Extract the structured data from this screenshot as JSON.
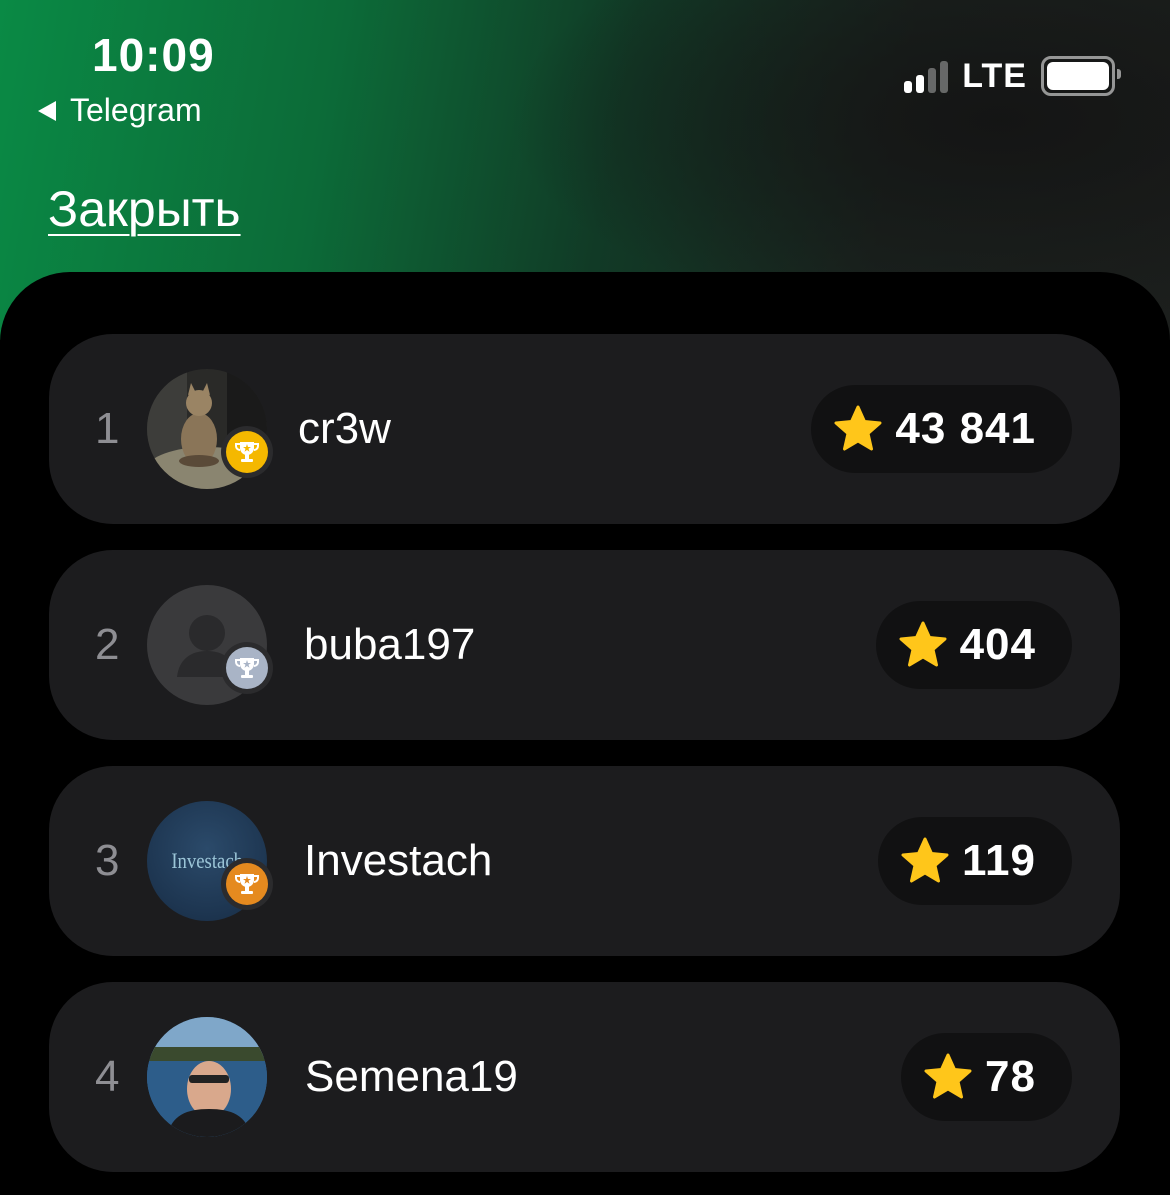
{
  "status_bar": {
    "time": "10:09",
    "back_app": "Telegram",
    "network": "LTE"
  },
  "header": {
    "close_label": "Закрыть"
  },
  "colors": {
    "gold_medal": "#f5b800",
    "silver_medal": "#a9b4c6",
    "bronze_medal": "#e58a1f",
    "star": "#ffc61a"
  },
  "leaderboard": [
    {
      "rank": "1",
      "name": "cr3w",
      "score": "43 841",
      "medal": "gold",
      "avatar": "cat-photo"
    },
    {
      "rank": "2",
      "name": "buba197",
      "score": "404",
      "medal": "silver",
      "avatar": "default-user"
    },
    {
      "rank": "3",
      "name": "Investach",
      "score": "119",
      "medal": "bronze",
      "avatar": "Investach",
      "avatar_text": "Investach"
    },
    {
      "rank": "4",
      "name": "Semena19",
      "score": "78",
      "medal": null,
      "avatar": "person-photo"
    }
  ]
}
